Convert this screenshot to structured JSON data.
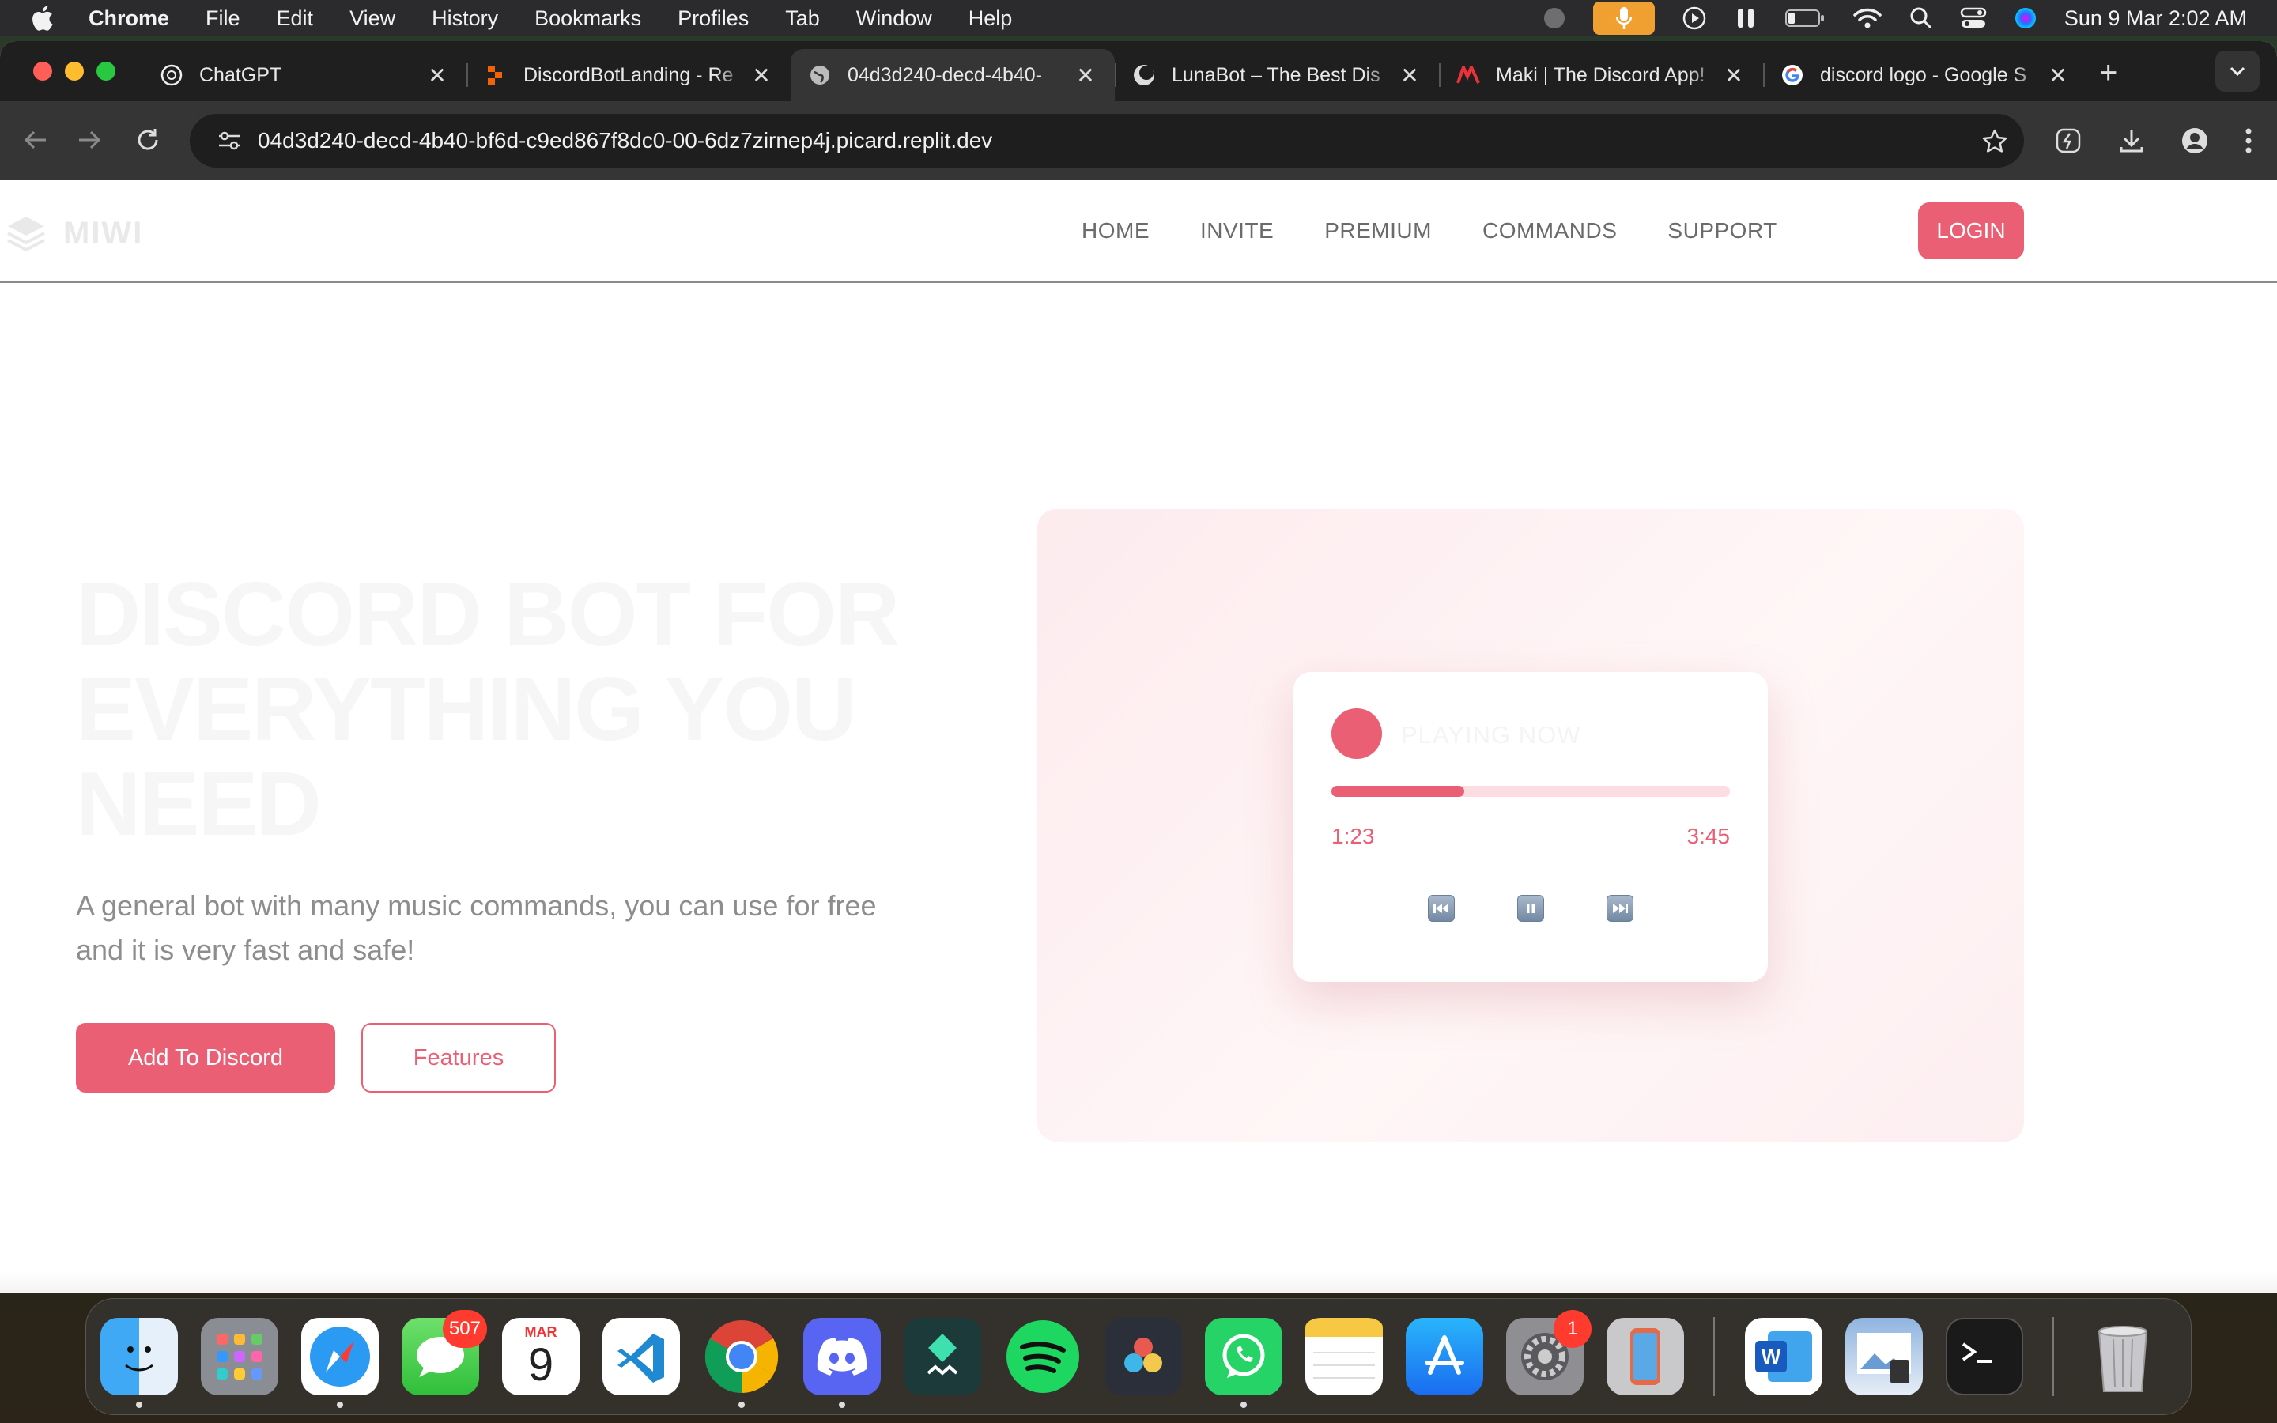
{
  "menubar": {
    "app": "Chrome",
    "items": [
      "File",
      "Edit",
      "View",
      "History",
      "Bookmarks",
      "Profiles",
      "Tab",
      "Window",
      "Help"
    ],
    "clock": "Sun 9 Mar  2:02 AM"
  },
  "browser": {
    "tabs": [
      {
        "title": "ChatGPT",
        "icon": "chatgpt-icon"
      },
      {
        "title": "DiscordBotLanding - Re",
        "icon": "replit-icon"
      },
      {
        "title": "04d3d240-decd-4b40-",
        "icon": "globe-icon",
        "active": true
      },
      {
        "title": "LunaBot – The Best Dis",
        "icon": "lunabot-icon"
      },
      {
        "title": "Maki | The Discord App!",
        "icon": "maki-icon"
      },
      {
        "title": "discord logo - Google S",
        "icon": "google-icon"
      }
    ],
    "url": "04d3d240-decd-4b40-bf6d-c9ed867f8dc0-00-6dz7zirnep4j.picard.replit.dev"
  },
  "site": {
    "logo": "MIWI",
    "nav": [
      "HOME",
      "INVITE",
      "PREMIUM",
      "COMMANDS",
      "SUPPORT"
    ],
    "login": "LOGIN",
    "hero": {
      "title_lines": [
        "DISCORD BOT FOR",
        "EVERYTHING YOU",
        "NEED"
      ],
      "subtitle": "A general bot with many music commands, you can use for free and it is very fast and safe!",
      "primary_button": "Add To Discord",
      "secondary_button": "Features"
    },
    "player": {
      "label": "PLAYING NOW",
      "elapsed": "1:23",
      "duration": "3:45",
      "progress": 0.334
    },
    "accent_color": "#ea5f74"
  },
  "dock": {
    "apps": [
      {
        "name": "Finder",
        "icon": "finder-icon",
        "running": true
      },
      {
        "name": "Launchpad",
        "icon": "launchpad-icon"
      },
      {
        "name": "Safari",
        "icon": "safari-icon",
        "running": true
      },
      {
        "name": "Messages",
        "icon": "messages-icon",
        "badge": "507"
      },
      {
        "name": "Calendar",
        "icon": "calendar-icon",
        "month": "MAR",
        "day": "9"
      },
      {
        "name": "Visual Studio Code",
        "icon": "vscode-icon"
      },
      {
        "name": "Chrome",
        "icon": "chrome-icon",
        "running": true
      },
      {
        "name": "Discord",
        "icon": "discord-icon",
        "running": true
      },
      {
        "name": "Filmora",
        "icon": "filmora-icon"
      },
      {
        "name": "Spotify",
        "icon": "spotify-icon"
      },
      {
        "name": "DaVinci Resolve",
        "icon": "davinci-icon"
      },
      {
        "name": "WhatsApp",
        "icon": "whatsapp-icon",
        "running": true
      },
      {
        "name": "Notes",
        "icon": "notes-icon"
      },
      {
        "name": "App Store",
        "icon": "appstore-icon"
      },
      {
        "name": "System Settings",
        "icon": "settings-icon",
        "badge": "1"
      },
      {
        "name": "iPhone Mirroring",
        "icon": "iphone-mirroring-icon"
      }
    ],
    "right_apps": [
      {
        "name": "Word",
        "icon": "word-icon"
      },
      {
        "name": "Preview",
        "icon": "preview-icon"
      },
      {
        "name": "Terminal",
        "icon": "terminal-icon"
      }
    ],
    "trash": {
      "name": "Trash",
      "icon": "trash-icon"
    }
  }
}
